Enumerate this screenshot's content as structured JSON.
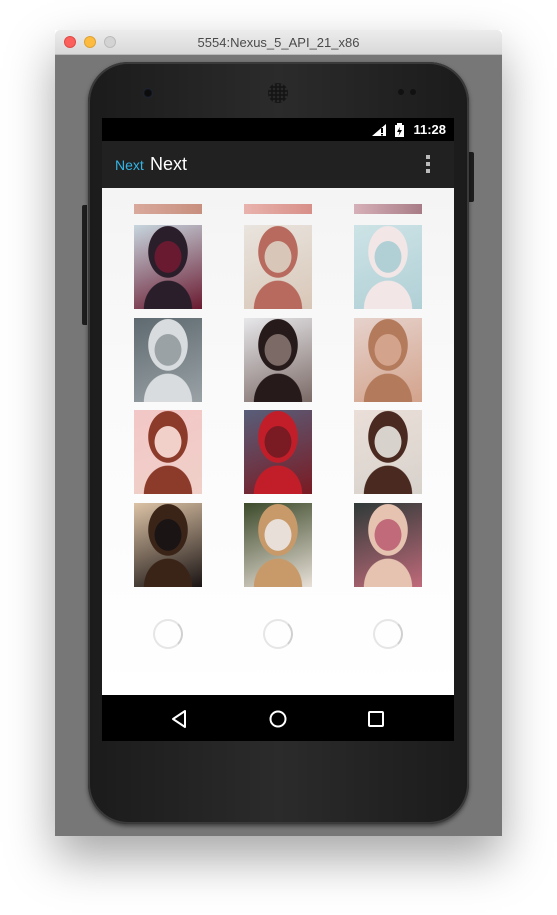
{
  "window": {
    "title": "5554:Nexus_5_API_21_x86"
  },
  "status_bar": {
    "time": "11:28"
  },
  "app_bar": {
    "subtitle": "Next",
    "title": "Next",
    "overflow_icon": "more-vert-icon"
  },
  "gallery": {
    "columns": 3,
    "partial_row": [
      {
        "id": "partial-1",
        "colors": [
          "#d9a99c",
          "#c78f7e"
        ]
      },
      {
        "id": "partial-2",
        "colors": [
          "#e9b3ad",
          "#d78f88"
        ]
      },
      {
        "id": "partial-3",
        "colors": [
          "#d6b0b8",
          "#a87c86"
        ]
      }
    ],
    "photos": [
      {
        "id": "photo-1",
        "colors": [
          "#c7d6de",
          "#2a1e2a",
          "#6a1a30"
        ]
      },
      {
        "id": "photo-2",
        "colors": [
          "#e9e4de",
          "#b86a5e",
          "#d8c7b8"
        ]
      },
      {
        "id": "photo-3",
        "colors": [
          "#cde3e6",
          "#f2e6e6",
          "#b0d0d6"
        ]
      },
      {
        "id": "photo-4",
        "colors": [
          "#5e6a70",
          "#d8dcde",
          "#9aa2a6"
        ]
      },
      {
        "id": "photo-5",
        "colors": [
          "#e7e7ea",
          "#261a1a",
          "#7b6a66"
        ]
      },
      {
        "id": "photo-6",
        "colors": [
          "#e6d2cc",
          "#b37a5c",
          "#d3a38c"
        ]
      },
      {
        "id": "photo-7",
        "colors": [
          "#f2c7c7",
          "#8c3a2a",
          "#f0d0c8"
        ]
      },
      {
        "id": "photo-8",
        "colors": [
          "#585e7a",
          "#c21e2a",
          "#7a1a22"
        ]
      },
      {
        "id": "photo-9",
        "colors": [
          "#eadfd8",
          "#4a2a20",
          "#d8d2cc"
        ]
      },
      {
        "id": "photo-10",
        "colors": [
          "#dcc3a6",
          "#3a2418",
          "#1a1414"
        ]
      },
      {
        "id": "photo-11",
        "colors": [
          "#3c4a2a",
          "#c89a6a",
          "#e8e0d8"
        ]
      },
      {
        "id": "photo-12",
        "colors": [
          "#2f3a38",
          "#e6c2b0",
          "#c06a7a"
        ]
      }
    ],
    "loaders": 3
  },
  "nav_bar": {
    "back_icon": "back-triangle-icon",
    "home_icon": "home-circle-icon",
    "recents_icon": "recents-square-icon"
  },
  "colors": {
    "accent": "#33b5e5",
    "app_bar": "#212121",
    "status_bar": "#000000"
  }
}
